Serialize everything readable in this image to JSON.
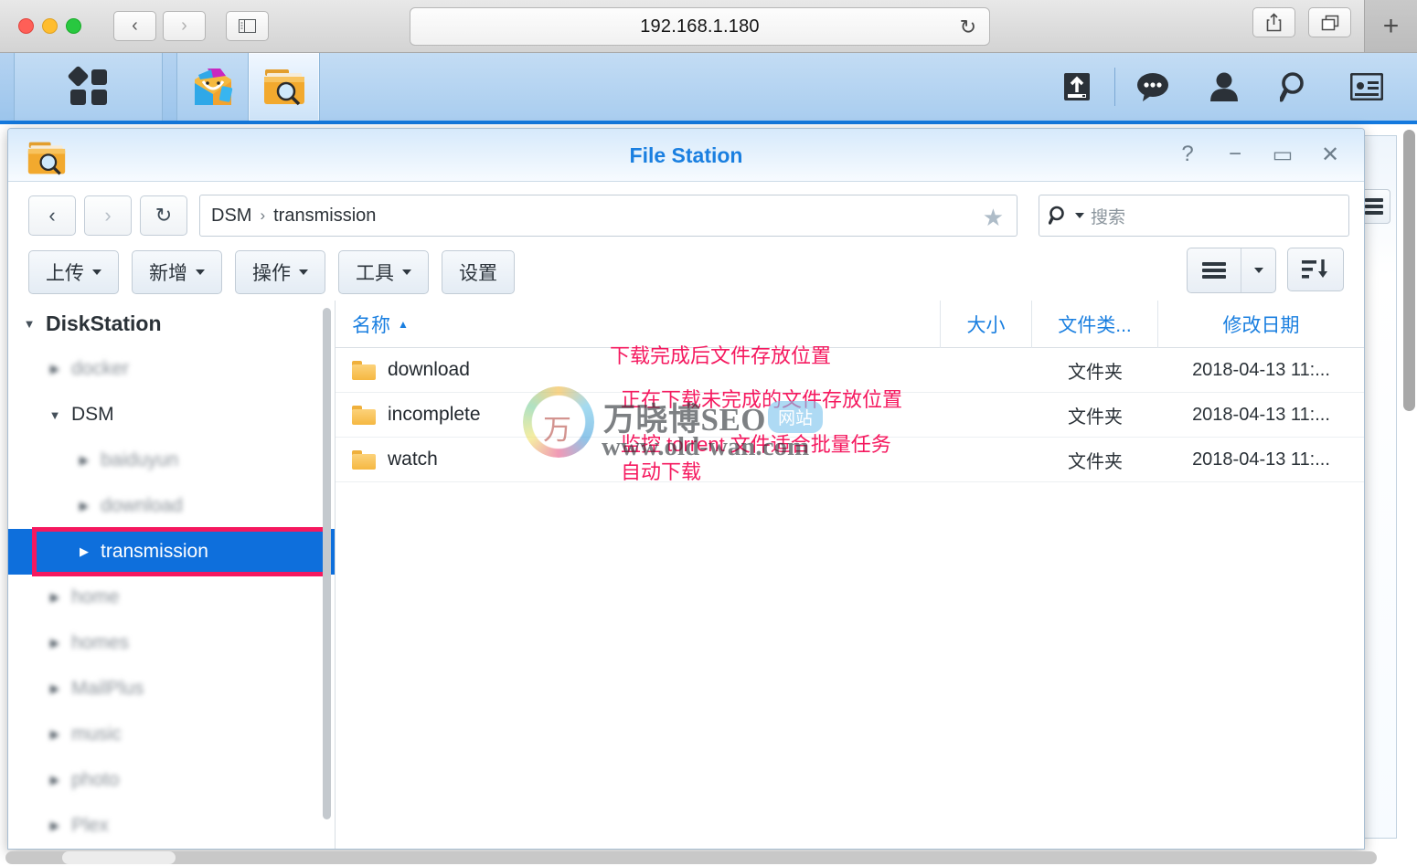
{
  "browser": {
    "url": "192.168.1.180",
    "back_icon": "chevron-left-icon",
    "forward_icon": "chevron-right-icon",
    "sidebar_icon": "sidebar-icon",
    "reload_icon": "reload-icon",
    "share_icon": "share-icon",
    "tabs_icon": "tab-overview-icon",
    "newtab_label": "+"
  },
  "dsm_taskbar": {
    "apps": [
      {
        "name": "main-menu",
        "icon": "grid-squares-icon"
      },
      {
        "name": "package-center",
        "icon": "package-center-icon"
      },
      {
        "name": "file-station",
        "icon": "file-station-icon",
        "active": true
      }
    ],
    "tray": [
      {
        "name": "upload-queue",
        "icon": "upload-icon"
      },
      {
        "name": "notifications-chat",
        "icon": "chat-bubble-icon"
      },
      {
        "name": "user-account",
        "icon": "person-icon"
      },
      {
        "name": "search",
        "icon": "magnifier-icon"
      },
      {
        "name": "widgets",
        "icon": "widget-card-icon"
      }
    ]
  },
  "window": {
    "title": "File Station",
    "controls": {
      "help": "?",
      "minimize": "−",
      "maximize": "▭",
      "close": "✕"
    }
  },
  "navbar": {
    "back": "‹",
    "forward": "›",
    "refresh": "↻",
    "breadcrumb": [
      "DSM",
      "transmission"
    ],
    "breadcrumb_separator": "›",
    "favorite_icon": "star-icon",
    "search_placeholder": "搜索"
  },
  "toolbar": {
    "buttons": [
      {
        "label": "上传",
        "has_caret": true
      },
      {
        "label": "新增",
        "has_caret": true
      },
      {
        "label": "操作",
        "has_caret": true
      },
      {
        "label": "工具",
        "has_caret": true
      },
      {
        "label": "设置",
        "has_caret": false
      }
    ],
    "view_icon": "list-view-icon",
    "view_caret_icon": "chevron-down-icon",
    "sort_icon": "sort-descending-icon"
  },
  "sidebar": {
    "items": [
      {
        "label": "DiskStation",
        "level": 0,
        "expanded": true,
        "blurred": false,
        "selected": false
      },
      {
        "label": "docker",
        "level": 1,
        "expanded": false,
        "blurred": true,
        "selected": false
      },
      {
        "label": "DSM",
        "level": 1,
        "expanded": true,
        "blurred": false,
        "selected": false
      },
      {
        "label": "baiduyun",
        "level": 2,
        "expanded": false,
        "blurred": true,
        "selected": false
      },
      {
        "label": "download",
        "level": 2,
        "expanded": false,
        "blurred": true,
        "selected": false
      },
      {
        "label": "transmission",
        "level": 2,
        "expanded": false,
        "blurred": false,
        "selected": true
      },
      {
        "label": "home",
        "level": 1,
        "expanded": false,
        "blurred": true,
        "selected": false
      },
      {
        "label": "homes",
        "level": 1,
        "expanded": false,
        "blurred": true,
        "selected": false
      },
      {
        "label": "MailPlus",
        "level": 1,
        "expanded": false,
        "blurred": true,
        "selected": false
      },
      {
        "label": "music",
        "level": 1,
        "expanded": false,
        "blurred": true,
        "selected": false
      },
      {
        "label": "photo",
        "level": 1,
        "expanded": false,
        "blurred": true,
        "selected": false
      },
      {
        "label": "Plex",
        "level": 1,
        "expanded": false,
        "blurred": true,
        "selected": false
      }
    ]
  },
  "filelist": {
    "columns": [
      {
        "label": "名称",
        "sorted": "asc",
        "sort_glyph": "▲"
      },
      {
        "label": "大小"
      },
      {
        "label": "文件类..."
      },
      {
        "label": "修改日期"
      }
    ],
    "rows": [
      {
        "name": "download",
        "size": "",
        "type": "文件夹",
        "modified": "2018-04-13 11:..."
      },
      {
        "name": "incomplete",
        "size": "",
        "type": "文件夹",
        "modified": "2018-04-13 11:..."
      },
      {
        "name": "watch",
        "size": "",
        "type": "文件夹",
        "modified": "2018-04-13 11:..."
      }
    ]
  },
  "annotations": [
    {
      "text": "下载完成后文件存放位置",
      "color": "#f5195f"
    },
    {
      "text": "正在下载未完成的文件存放位置",
      "color": "#f5195f"
    },
    {
      "text": "监控 torrent 文件适合批量任务\n自动下载",
      "color": "#f5195f"
    }
  ],
  "watermark": {
    "logo_char": "万",
    "brand": "万晓博SEO",
    "badge": "网站",
    "url": "www.old-wan.com"
  },
  "colors": {
    "accent_blue": "#1a7fe0",
    "selection_blue": "#0e6fdc",
    "annotation_pink": "#f5195f",
    "taskbar_blue": "#1479de"
  }
}
